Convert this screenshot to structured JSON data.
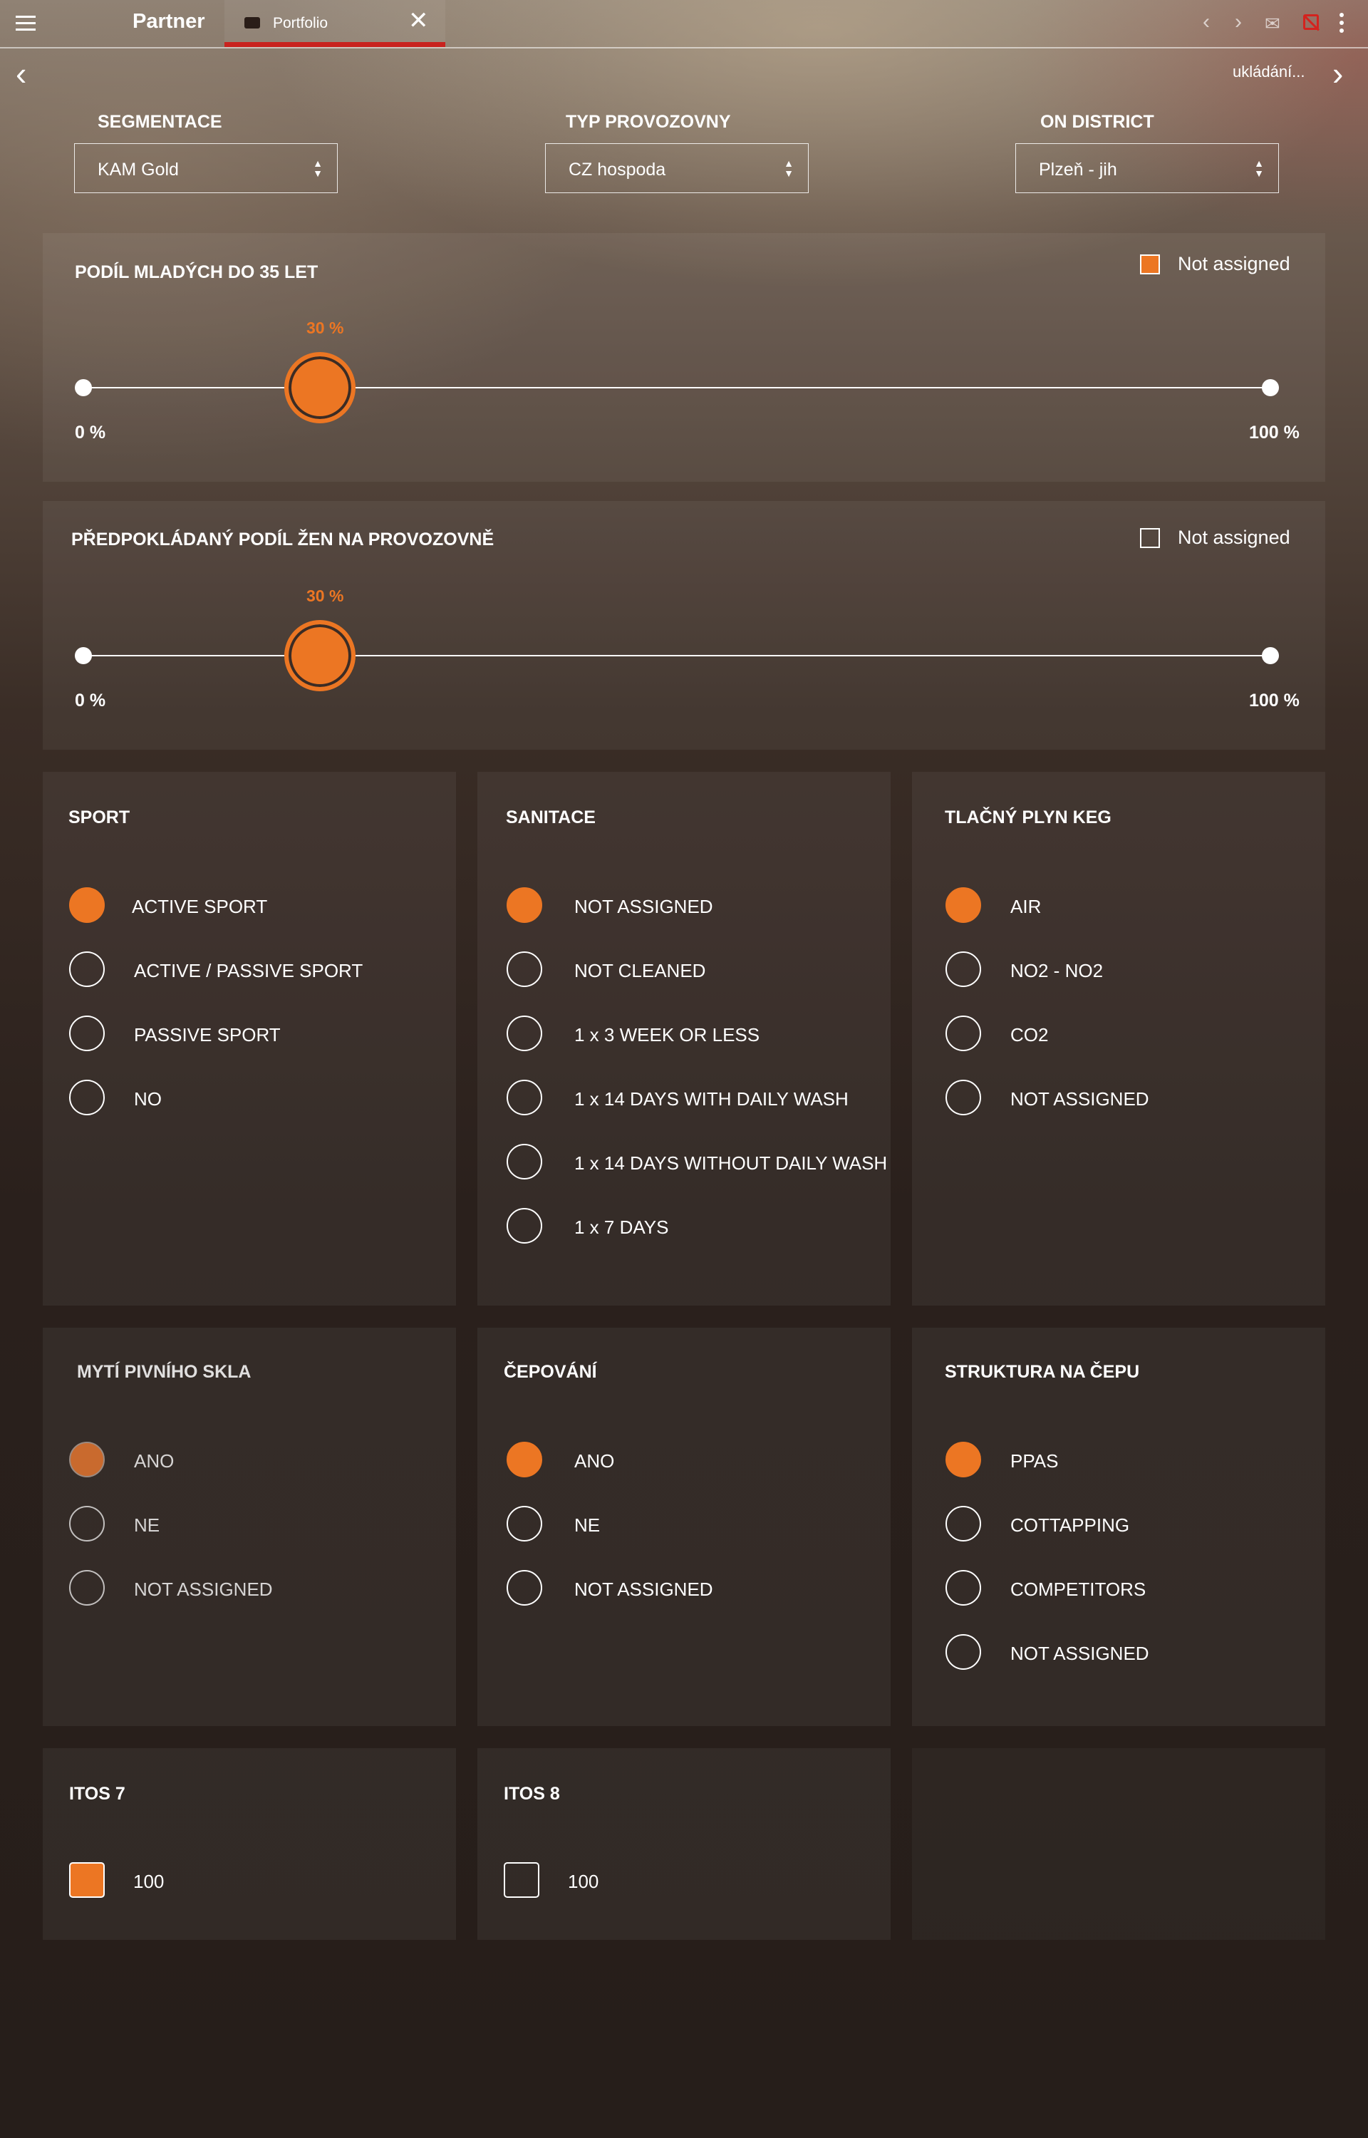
{
  "app": {
    "title": "Partner",
    "saving_status": "ukládání..."
  },
  "tabs": [
    {
      "label": "Portfolio",
      "active": true
    }
  ],
  "filters": [
    {
      "label": "SEGMENTACE",
      "value": "KAM Gold"
    },
    {
      "label": "TYP PROVOZOVNY",
      "value": "CZ hospoda"
    },
    {
      "label": "ON DISTRICT",
      "value": "Plzeň - jih"
    }
  ],
  "sliders": [
    {
      "title": "PODÍL MLADÝCH DO 35 LET",
      "value_label": "30 %",
      "value": 0.2,
      "min_label": "0 %",
      "max_label": "100 %",
      "not_assigned_label": "Not assigned",
      "not_assigned_checked": true
    },
    {
      "title": "PŘEDPOKLÁDANÝ PODÍL ŽEN NA PROVOZOVNĚ",
      "value_label": "30 %",
      "value": 0.2,
      "min_label": "0 %",
      "max_label": "100 %",
      "not_assigned_label": "Not assigned",
      "not_assigned_checked": false
    }
  ],
  "radio_groups": [
    {
      "title": "SPORT",
      "selected": 0,
      "options": [
        "ACTIVE SPORT",
        "ACTIVE / PASSIVE SPORT",
        "PASSIVE SPORT",
        "NO"
      ]
    },
    {
      "title": "SANITACE",
      "selected": 0,
      "options": [
        "NOT ASSIGNED",
        "NOT CLEANED",
        "1 x 3 WEEK OR LESS",
        "1 x 14 DAYS WITH DAILY WASH",
        "1 x 14 DAYS WITHOUT DAILY WASH",
        "1 x 7 DAYS"
      ]
    },
    {
      "title": "TLAČNÝ PLYN KEG",
      "selected": 0,
      "options": [
        "AIR",
        "NO2 - NO2",
        "CO2",
        "NOT ASSIGNED"
      ]
    },
    {
      "title": "MYTÍ PIVNÍHO SKLA",
      "selected": 0,
      "disabled": true,
      "options": [
        "ANO",
        "NE",
        "NOT ASSIGNED"
      ]
    },
    {
      "title": "ČEPOVÁNÍ",
      "selected": 0,
      "options": [
        "ANO",
        "NE",
        "NOT ASSIGNED"
      ]
    },
    {
      "title": "STRUKTURA NA ČEPU",
      "selected": 0,
      "options": [
        "PPAS",
        "COTTAPPING",
        "COMPETITORS",
        "NOT ASSIGNED"
      ]
    }
  ],
  "checkbox_cards": [
    {
      "title": "ITOS 7",
      "label": "100",
      "checked": true
    },
    {
      "title": "ITOS 8",
      "label": "100",
      "checked": false
    }
  ],
  "colors": {
    "accent": "#ec7623",
    "tab_underline": "#c8231f",
    "offline_icon": "#d4231e"
  },
  "icons": [
    "hamburger-icon",
    "tab-briefcase-icon",
    "close-icon",
    "chevron-left-icon",
    "chevron-right-icon",
    "mail-icon",
    "sync-off-icon",
    "more-vert-icon"
  ]
}
